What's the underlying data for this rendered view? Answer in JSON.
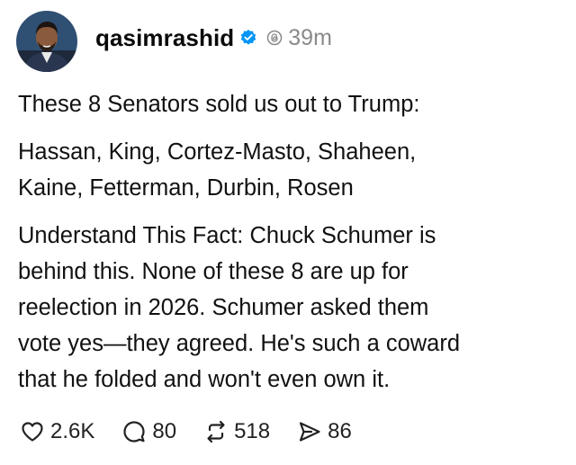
{
  "post": {
    "author": {
      "username": "qasimrashid",
      "verified": true,
      "time": "39m"
    },
    "paragraphs": [
      {
        "lines": [
          "These 8 Senators sold us out to Trump:"
        ]
      },
      {
        "lines": [
          "Hassan, King, Cortez-Masto, Shaheen,",
          "Kaine, Fetterman, Durbin, Rosen"
        ]
      },
      {
        "lines": [
          "Understand This Fact: Chuck Schumer is",
          "behind this. None of these 8 are up for",
          "reelection in 2026. Schumer asked them",
          "vote yes—they agreed. He's such a coward",
          "that he folded and won't even own it."
        ]
      }
    ],
    "actions": {
      "like_count": "2.6K",
      "reply_count": "80",
      "repost_count": "518",
      "share_count": "86"
    }
  },
  "colors": {
    "verified": "#0095f6",
    "muted": "#8a8a8a",
    "text": "#111111"
  },
  "icons": {
    "like": "heart-icon",
    "reply": "comment-icon",
    "repost": "repost-icon",
    "share": "share-icon",
    "verified": "verified-badge-icon",
    "threads": "threads-logo-icon"
  }
}
